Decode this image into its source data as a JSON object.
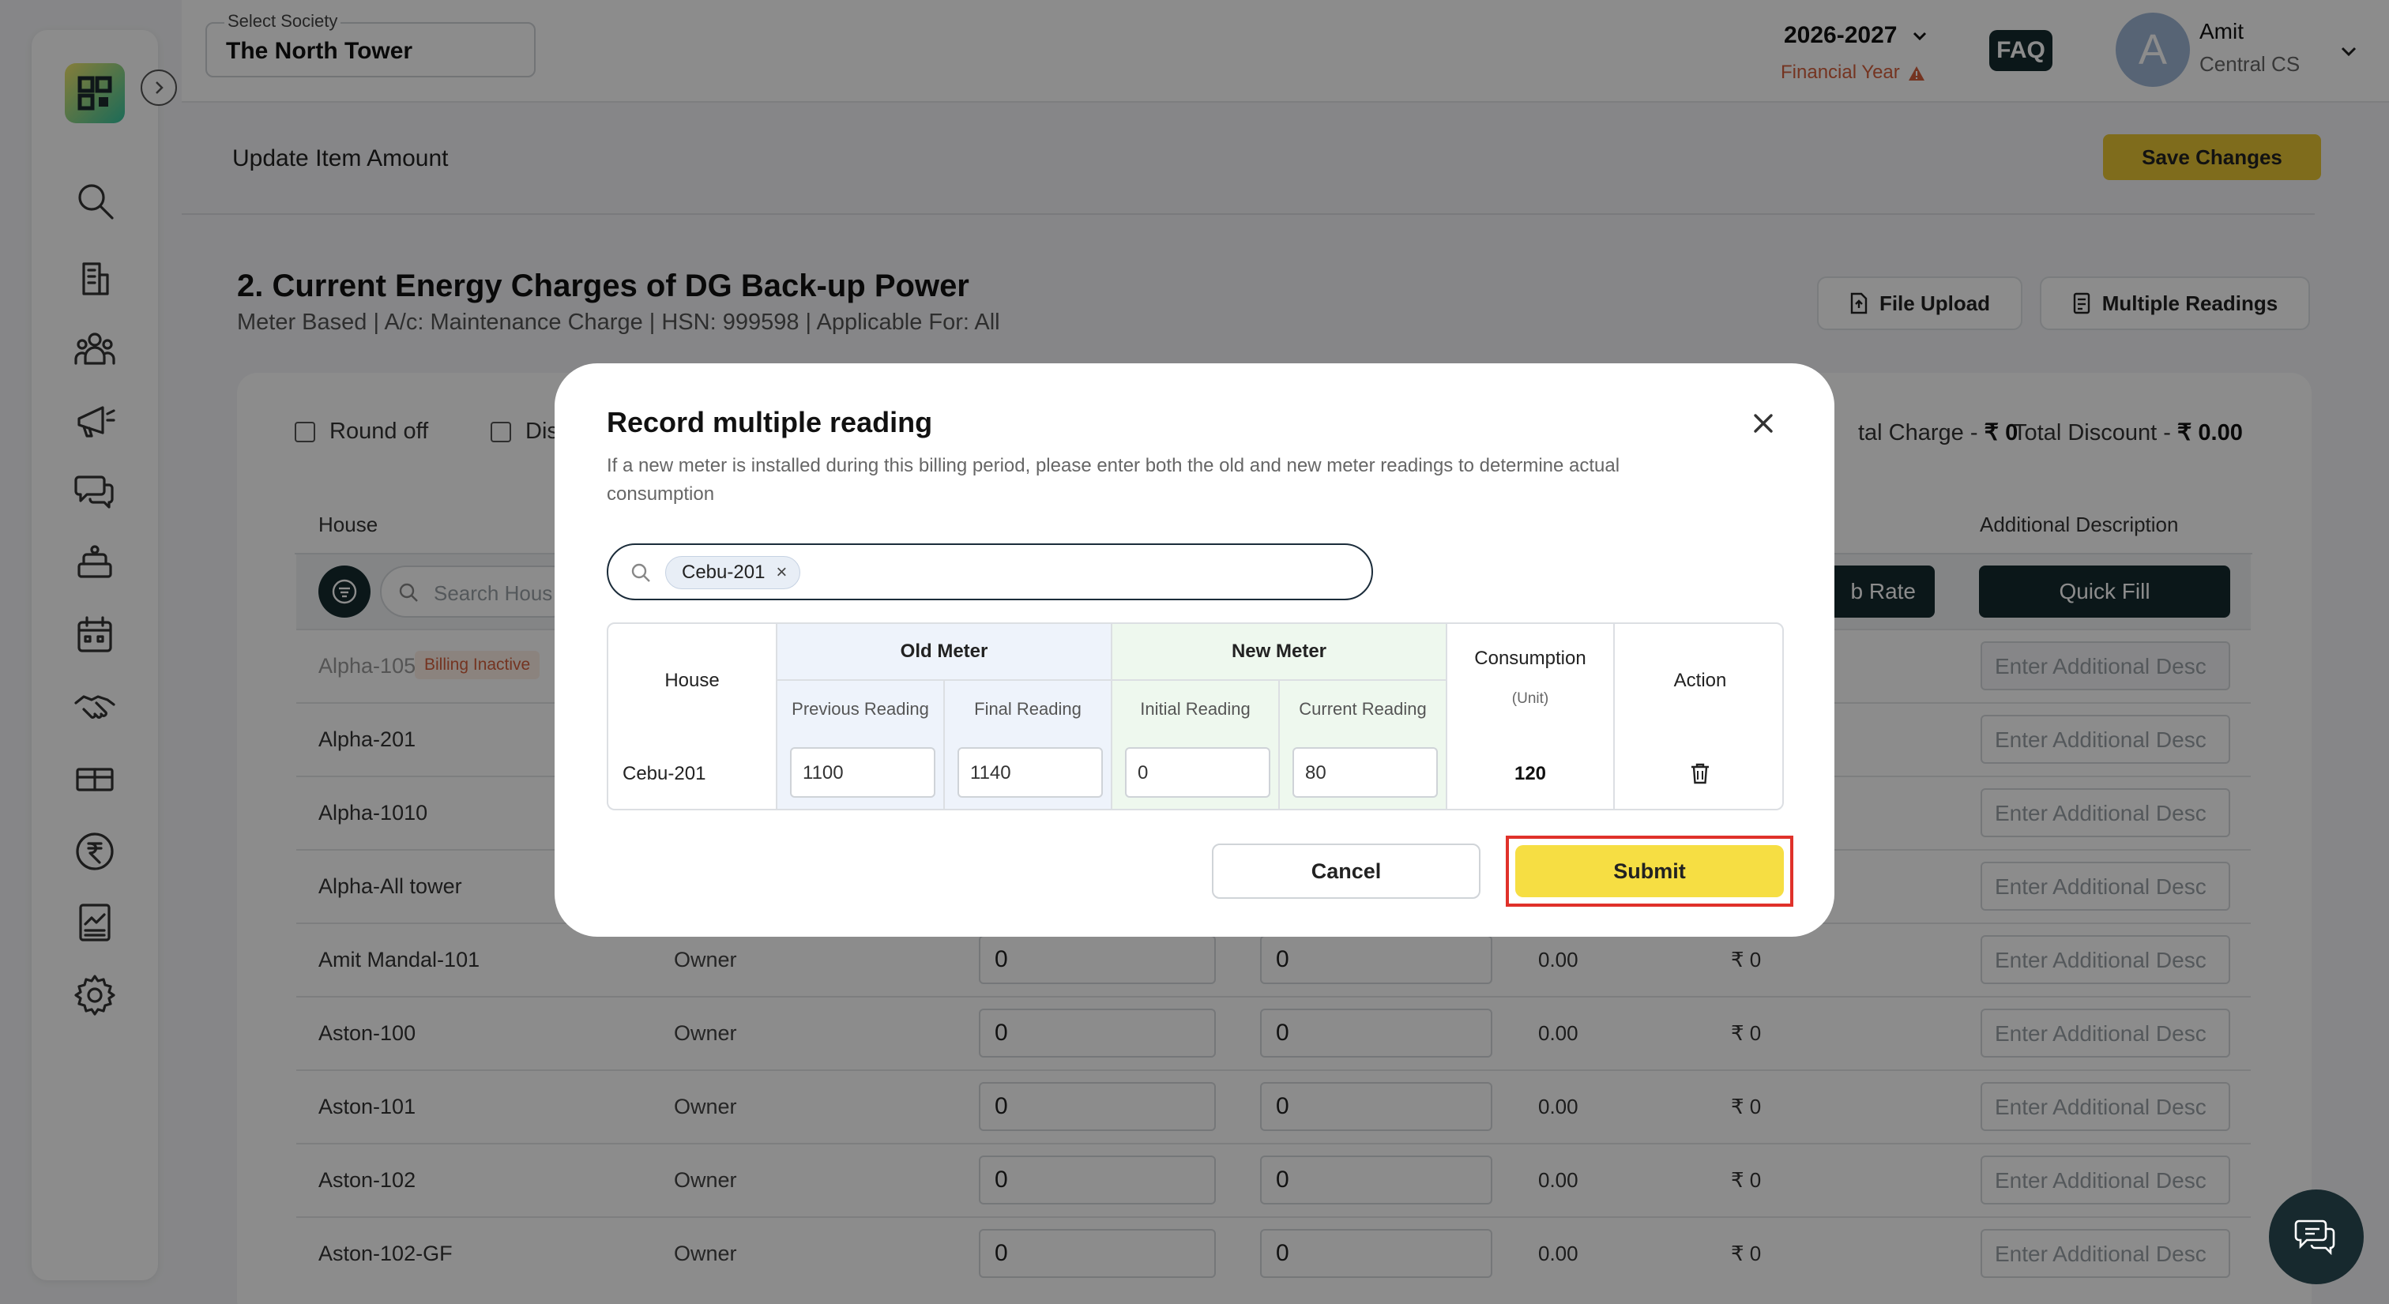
{
  "topbar": {
    "society_label": "Select Society",
    "society_value": "The North Tower",
    "financial_year": "2026-2027",
    "financial_year_label": "Financial Year",
    "faq_label": "FAQ",
    "user_initial": "A",
    "user_name": "Amit",
    "user_role": "Central CS"
  },
  "sidebar": {
    "items": [
      "search-icon",
      "building-icon",
      "members-icon",
      "announcement-icon",
      "chat-icon",
      "facility-icon",
      "calendar-icon",
      "handshake-icon",
      "package-icon",
      "rupee-icon",
      "report-icon",
      "settings-icon"
    ]
  },
  "page": {
    "title": "Update Item Amount",
    "save_label": "Save Changes"
  },
  "section": {
    "title": "2. Current Energy Charges of DG Back-up Power",
    "subtitle": "Meter Based | A/c: Maintenance Charge | HSN: 999598 | Applicable For: All",
    "file_upload_label": "File Upload",
    "multiple_readings_label": "Multiple Readings",
    "round_off_label": "Round off",
    "discount_label_partial": "Dis",
    "total_charge_label": "tal Charge - ",
    "total_charge_value": "₹ 0",
    "total_discount_label": "Total Discount - ",
    "total_discount_value": "₹ 0.00"
  },
  "table": {
    "header_house": "House",
    "header_additional": "Additional Description",
    "search_placeholder": "Search Hous",
    "slab_rate_label": "b Rate",
    "quick_fill_label": "Quick Fill",
    "inactive_badge": "Billing Inactive",
    "desc_placeholder": "Enter Additional Desc",
    "rows": [
      {
        "house": "Alpha-105",
        "owner": "",
        "inactive": true
      },
      {
        "house": "Alpha-201",
        "owner": ""
      },
      {
        "house": "Alpha-1010",
        "owner": ""
      },
      {
        "house": "Alpha-All tower",
        "owner": ""
      },
      {
        "house": "Amit Mandal-101",
        "owner": "Owner",
        "prev": "0",
        "curr": "0",
        "units": "0.00",
        "amount": "₹ 0"
      },
      {
        "house": "Aston-100",
        "owner": "Owner",
        "prev": "0",
        "curr": "0",
        "units": "0.00",
        "amount": "₹ 0"
      },
      {
        "house": "Aston-101",
        "owner": "Owner",
        "prev": "0",
        "curr": "0",
        "units": "0.00",
        "amount": "₹ 0"
      },
      {
        "house": "Aston-102",
        "owner": "Owner",
        "prev": "0",
        "curr": "0",
        "units": "0.00",
        "amount": "₹ 0"
      },
      {
        "house": "Aston-102-GF",
        "owner": "Owner",
        "prev": "0",
        "curr": "0",
        "units": "0.00",
        "amount": "₹ 0"
      }
    ]
  },
  "modal": {
    "title": "Record multiple reading",
    "description": "If a new meter is installed during this billing period, please enter both the old and new meter readings to determine actual consumption",
    "chip_label": "Cebu-201",
    "col_house": "House",
    "group_old": "Old Meter",
    "group_new": "New Meter",
    "col_prev": "Previous Reading",
    "col_final": "Final Reading",
    "col_initial": "Initial Reading",
    "col_current": "Current Reading",
    "col_consumption": "Consumption",
    "col_unit": "(Unit)",
    "col_action": "Action",
    "row": {
      "house": "Cebu-201",
      "previous": "1100",
      "final": "1140",
      "initial": "0",
      "current": "80",
      "consumption": "120"
    },
    "cancel_label": "Cancel",
    "submit_label": "Submit"
  },
  "colors": {
    "accent_yellow": "#f6de43",
    "save_yellow": "#e7c533",
    "dark": "#152a2e",
    "warning": "#d4603c",
    "highlight_red": "#e0312a",
    "old_meter_bg": "#eef3fb",
    "new_meter_bg": "#eef8ee"
  }
}
